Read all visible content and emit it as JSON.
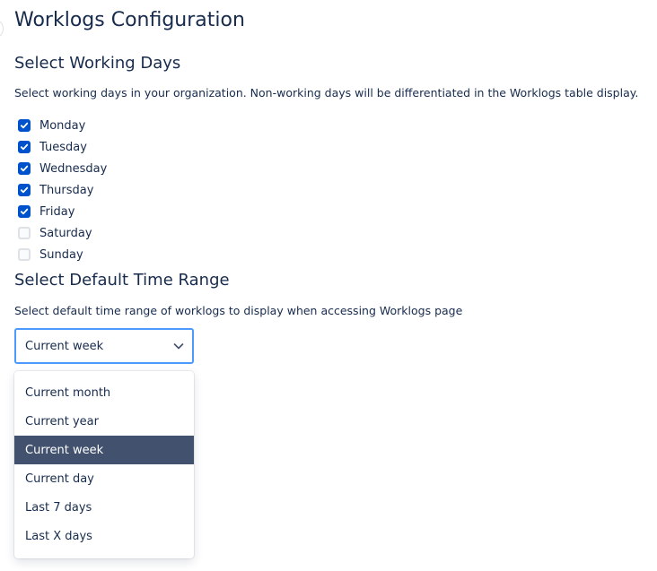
{
  "page": {
    "title": "Worklogs Configuration"
  },
  "working_days": {
    "heading": "Select Working Days",
    "description": "Select working days in your organization. Non-working days will be differentiated in the Worklogs table display.",
    "days": [
      {
        "label": "Monday",
        "checked": true
      },
      {
        "label": "Tuesday",
        "checked": true
      },
      {
        "label": "Wednesday",
        "checked": true
      },
      {
        "label": "Thursday",
        "checked": true
      },
      {
        "label": "Friday",
        "checked": true
      },
      {
        "label": "Saturday",
        "checked": false
      },
      {
        "label": "Sunday",
        "checked": false
      }
    ]
  },
  "time_range": {
    "heading": "Select Default Time Range",
    "description": "Select default time range of worklogs to display when accessing Worklogs page",
    "selected_value": "Current week",
    "options": [
      {
        "label": "Current month",
        "selected": false
      },
      {
        "label": "Current year",
        "selected": false
      },
      {
        "label": "Current week",
        "selected": true
      },
      {
        "label": "Current day",
        "selected": false
      },
      {
        "label": "Last 7 days",
        "selected": false
      },
      {
        "label": "Last X days",
        "selected": false
      }
    ]
  },
  "icons": {
    "checkbox_checked": "check-icon",
    "dropdown": "chevron-down-icon"
  },
  "colors": {
    "text": "#172b4d",
    "checkbox_checked": "#0052cc",
    "select_focus_border": "#4c9aff",
    "menu_selected_bg": "#42526e"
  }
}
